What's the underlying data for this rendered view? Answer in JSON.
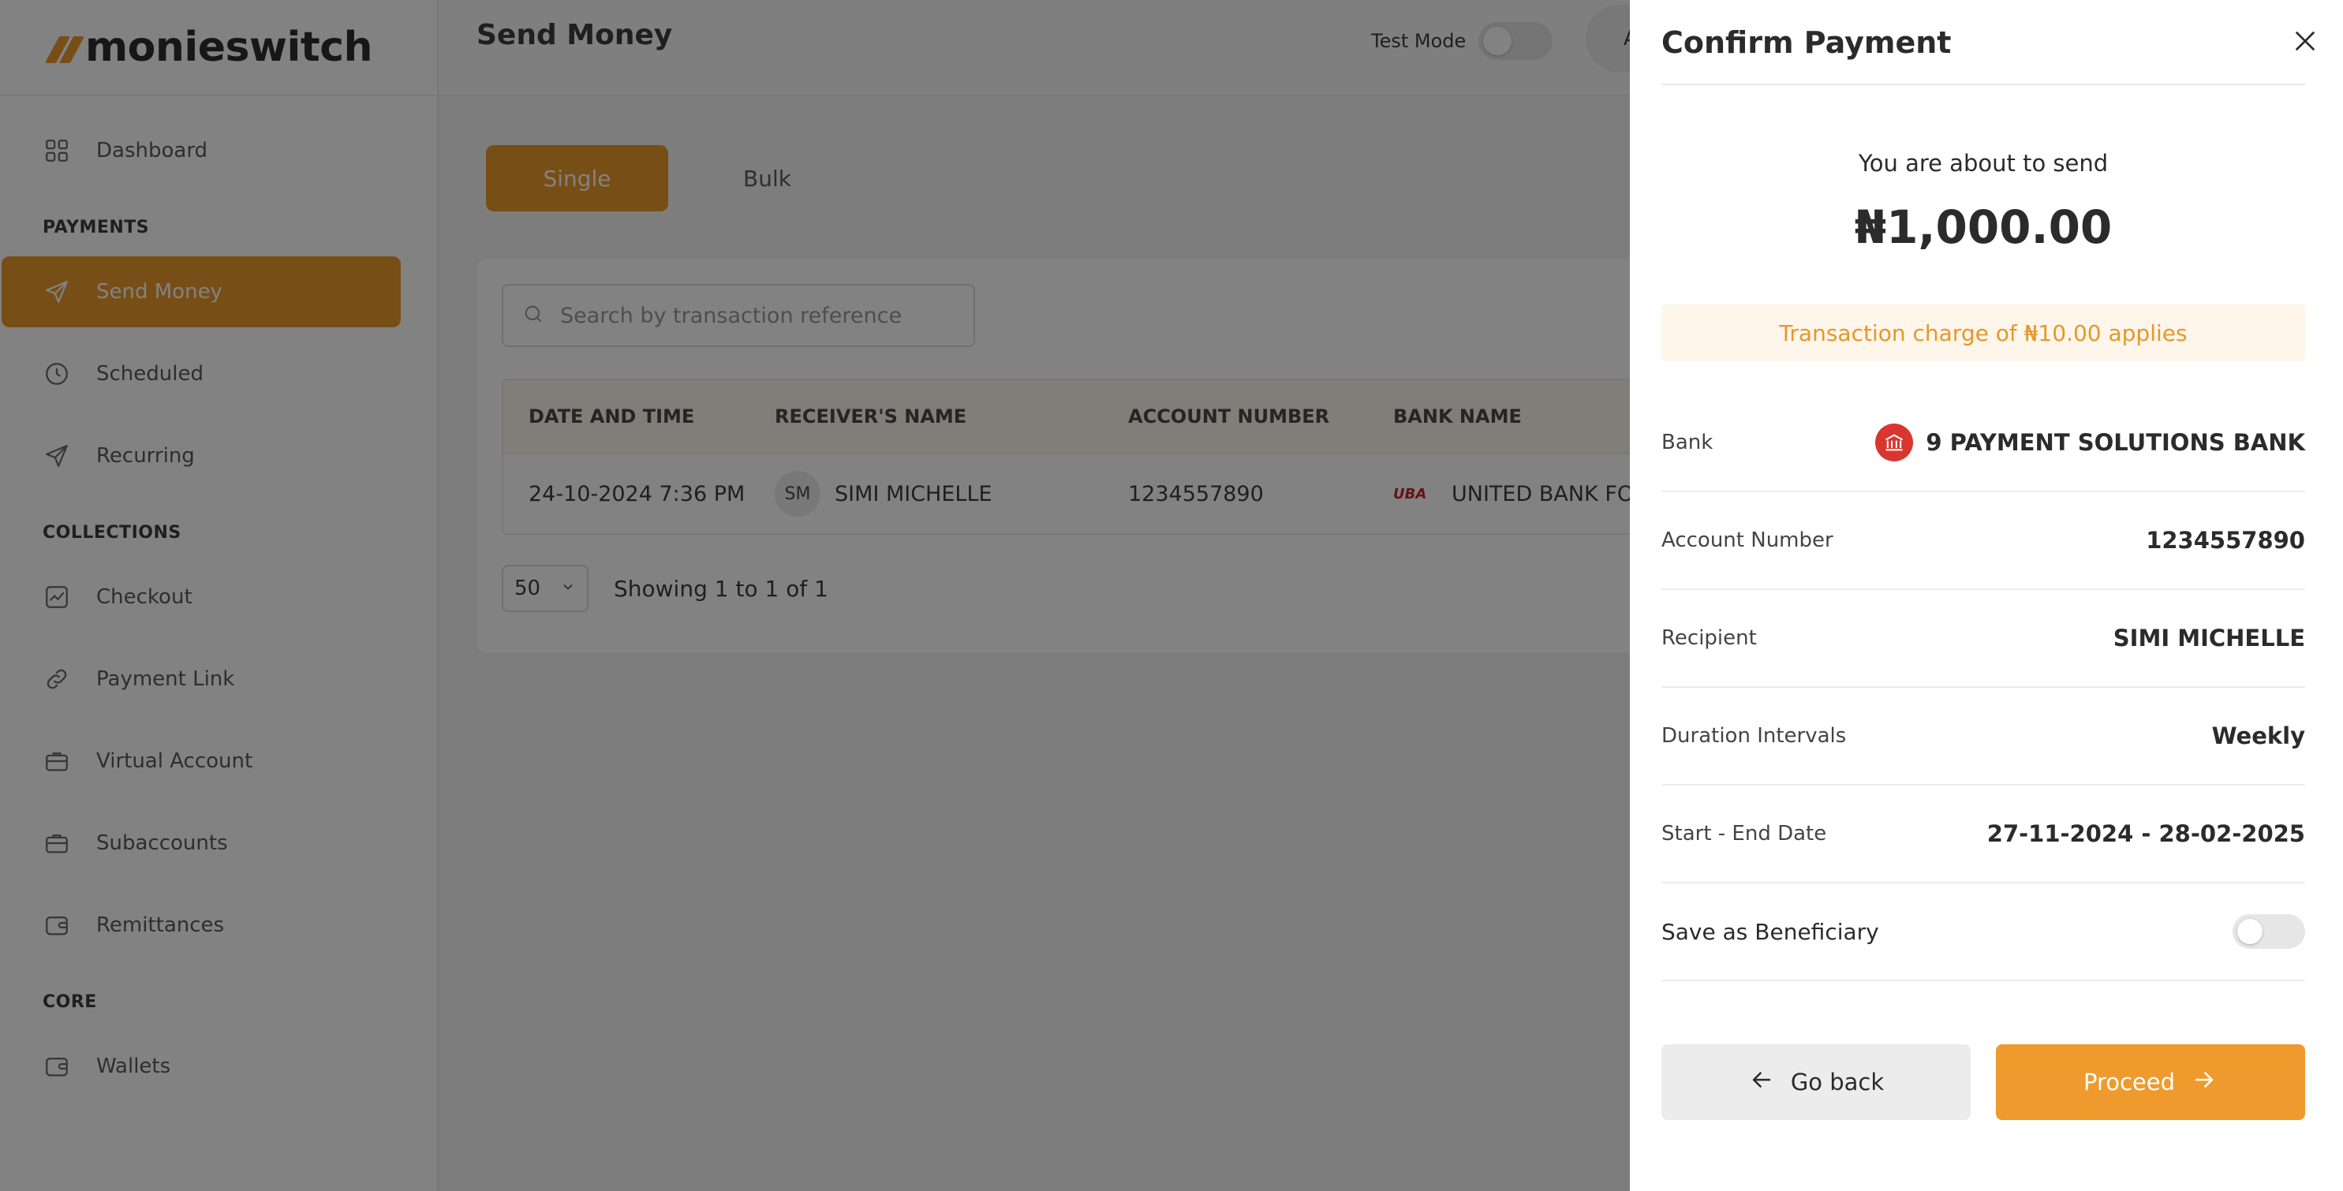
{
  "brand": {
    "name": "monieswitch"
  },
  "sidebar": {
    "items_top": [
      {
        "label": "Dashboard",
        "icon": "grid-icon"
      }
    ],
    "sections": [
      {
        "title": "PAYMENTS",
        "items": [
          {
            "label": "Send Money",
            "icon": "send-icon",
            "active": true
          },
          {
            "label": "Scheduled",
            "icon": "clock-icon"
          },
          {
            "label": "Recurring",
            "icon": "send-icon"
          }
        ]
      },
      {
        "title": "COLLECTIONS",
        "items": [
          {
            "label": "Checkout",
            "icon": "chart-icon"
          },
          {
            "label": "Payment Link",
            "icon": "link-icon"
          },
          {
            "label": "Virtual Account",
            "icon": "briefcase-icon"
          },
          {
            "label": "Subaccounts",
            "icon": "briefcase-icon"
          },
          {
            "label": "Remittances",
            "icon": "wallet-icon"
          }
        ]
      },
      {
        "title": "CORE",
        "items": [
          {
            "label": "Wallets",
            "icon": "wallet-icon"
          }
        ]
      }
    ]
  },
  "header": {
    "title": "Send Money",
    "test_mode_label": "Test Mode",
    "avatar_initial": "A"
  },
  "tabs": {
    "single": "Single",
    "bulk": "Bulk"
  },
  "search": {
    "placeholder": "Search by transaction reference"
  },
  "table": {
    "columns": [
      "DATE AND TIME",
      "RECEIVER'S NAME",
      "ACCOUNT NUMBER",
      "BANK NAME"
    ],
    "rows": [
      {
        "datetime": "24-10-2024 7:36 PM",
        "initials": "SM",
        "receiver": "SIMI MICHELLE",
        "account": "1234557890",
        "bank_logo": "UBA",
        "bank": "UNITED BANK FOR AFRICA"
      }
    ]
  },
  "pagination": {
    "page_size": "50",
    "summary": "Showing 1 to 1 of 1"
  },
  "modal": {
    "title": "Confirm Payment",
    "about_text": "You are about to send",
    "amount": "₦1,000.00",
    "charge_notice": "Transaction charge of ₦10.00 applies",
    "details": [
      {
        "label": "Bank",
        "value": "9 PAYMENT SOLUTIONS BANK"
      },
      {
        "label": "Account Number",
        "value": "1234557890"
      },
      {
        "label": "Recipient",
        "value": "SIMI MICHELLE"
      },
      {
        "label": "Duration Intervals",
        "value": "Weekly"
      },
      {
        "label": "Start - End Date",
        "value": "27-11-2024 - 28-02-2025"
      }
    ],
    "save_beneficiary_label": "Save as Beneficiary",
    "go_back_label": "Go back",
    "proceed_label": "Proceed"
  },
  "colors": {
    "accent": "#E99A2C",
    "bank_badge": "#D9362F",
    "charge_text": "#E9962B",
    "charge_bg": "#FEF6EA"
  }
}
